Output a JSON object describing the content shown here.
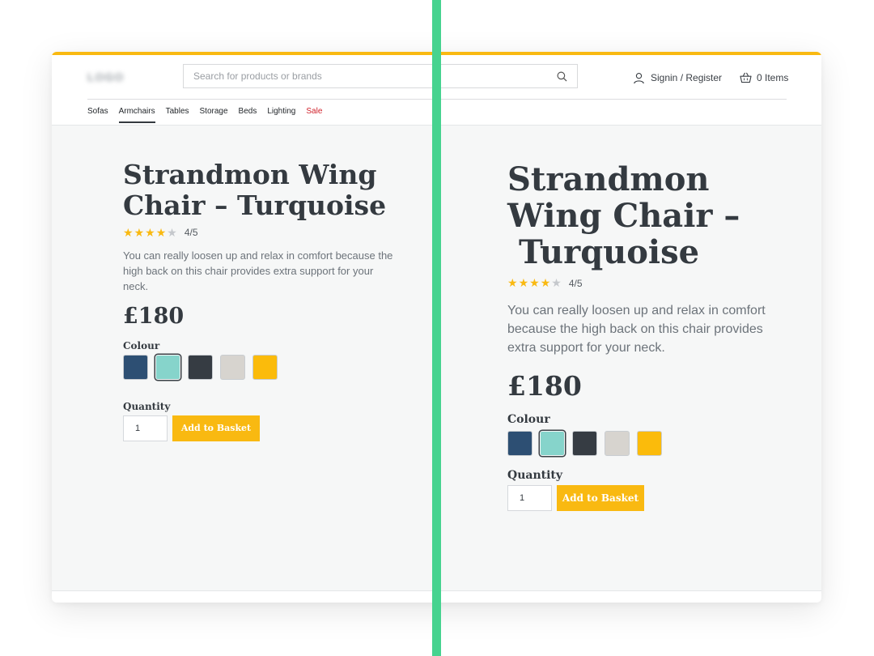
{
  "header": {
    "search_placeholder": "Search for products or brands",
    "account_label": "Signin / Register",
    "basket_label": "0 Items",
    "accent_color": "#f9b911"
  },
  "nav": {
    "items": [
      "Sofas",
      "Armchairs",
      "Tables",
      "Storage",
      "Beds",
      "Lighting",
      "Sale"
    ],
    "active": "Armchairs",
    "sale_color": "#d0212b"
  },
  "product": {
    "title_line1": "Strandmon Wing Chair – Turquoise",
    "title_right_1": "Strandmon",
    "title_right_2": "Wing Chair –",
    "title_right_3": "Turquoise",
    "rating": 4,
    "rating_max": 5,
    "rating_text": "4/5",
    "description": "You can really loosen up and relax in comfort because the high back on this chair provides extra support for your neck.",
    "price": "£180",
    "colour_label": "Colour",
    "colours": [
      {
        "name": "navy",
        "hex": "#2d4f73"
      },
      {
        "name": "turquoise",
        "hex": "#86d4cb",
        "selected": true
      },
      {
        "name": "charcoal",
        "hex": "#363c43"
      },
      {
        "name": "light-grey",
        "hex": "#d7d4cf"
      },
      {
        "name": "yellow",
        "hex": "#fbbb0b"
      }
    ],
    "quantity_label": "Quantity",
    "quantity_value": "1",
    "add_button_label": "Add to Basket"
  },
  "divider_color": "#46d38f"
}
